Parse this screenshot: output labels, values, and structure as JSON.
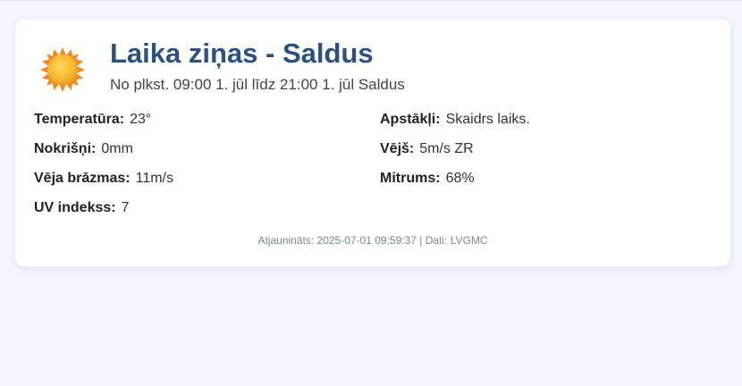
{
  "header": {
    "icon": "sun-icon",
    "title": "Laika ziņas - Saldus",
    "subtitle": "No plkst. 09:00 1. jūl līdz 21:00 1. jūl Saldus"
  },
  "weather": {
    "temperature": {
      "label": "Temperatūra:",
      "value": "23°"
    },
    "conditions": {
      "label": "Apstākļi:",
      "value": "Skaidrs laiks."
    },
    "precipitation": {
      "label": "Nokrišņi:",
      "value": "0mm"
    },
    "wind": {
      "label": "Vējš:",
      "value": "5m/s ZR"
    },
    "gusts": {
      "label": "Vēja brāzmas:",
      "value": "11m/s"
    },
    "humidity": {
      "label": "Mitrums:",
      "value": "68%"
    },
    "uv": {
      "label": "UV indekss:",
      "value": "7"
    }
  },
  "footer": {
    "text": "Atjaunināts: 2025-07-01 09:59:37 | Dati: LVGMC"
  },
  "colors": {
    "title": "#2b5180",
    "background": "#f3f6fc",
    "sun": "#f5b82e",
    "sun_rays": "#f08a24"
  }
}
